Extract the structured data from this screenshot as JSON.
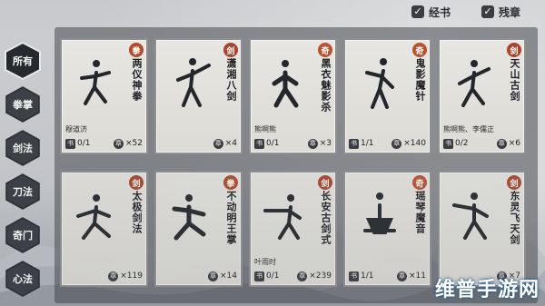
{
  "sidebar": {
    "items": [
      {
        "label": "所有",
        "active": true
      },
      {
        "label": "拳掌",
        "active": false
      },
      {
        "label": "剑法",
        "active": false
      },
      {
        "label": "刀法",
        "active": false
      },
      {
        "label": "奇门",
        "active": false
      },
      {
        "label": "心法",
        "active": false
      }
    ]
  },
  "filters": {
    "scripture_label": "经书",
    "scripture_checked": true,
    "fragment_label": "残章",
    "fragment_checked": true
  },
  "badge_colors": {
    "拳": "#b14a2a",
    "剑": "#a8452c",
    "奇": "#b8532e"
  },
  "cards": [
    {
      "type": "拳",
      "name": "两仪神拳",
      "owner": "穆道济",
      "books": "0/1",
      "fragments": "×52"
    },
    {
      "type": "剑",
      "name": "潇湘八剑",
      "owner": "",
      "books": "",
      "fragments": "×4"
    },
    {
      "type": "奇",
      "name": "黑衣魅影杀",
      "owner": "熊啊熊",
      "books": "0/1",
      "fragments": "×3"
    },
    {
      "type": "奇",
      "name": "鬼影魔针",
      "owner": "",
      "books": "1/1",
      "fragments": "×140"
    },
    {
      "type": "剑",
      "name": "天山古剑",
      "owner": "熊啊熊、李儒正",
      "books": "0/2",
      "fragments": "×6"
    },
    {
      "type": "剑",
      "name": "太极剑法",
      "owner": "",
      "books": "",
      "fragments": "×119"
    },
    {
      "type": "拳",
      "name": "不动明王掌",
      "owner": "",
      "books": "",
      "fragments": "×14"
    },
    {
      "type": "剑",
      "name": "长安古剑式",
      "owner": "叶雨时",
      "books": "0/1",
      "fragments": "×239"
    },
    {
      "type": "奇",
      "name": "瑶琴魔音",
      "owner": "",
      "books": "1/1",
      "fragments": "×11"
    },
    {
      "type": "剑",
      "name": "东灵飞天剑",
      "owner": "",
      "books": "",
      "fragments": "×7"
    }
  ],
  "icons": {
    "book": "书",
    "fragment": "章"
  },
  "watermark": "维普手游网"
}
